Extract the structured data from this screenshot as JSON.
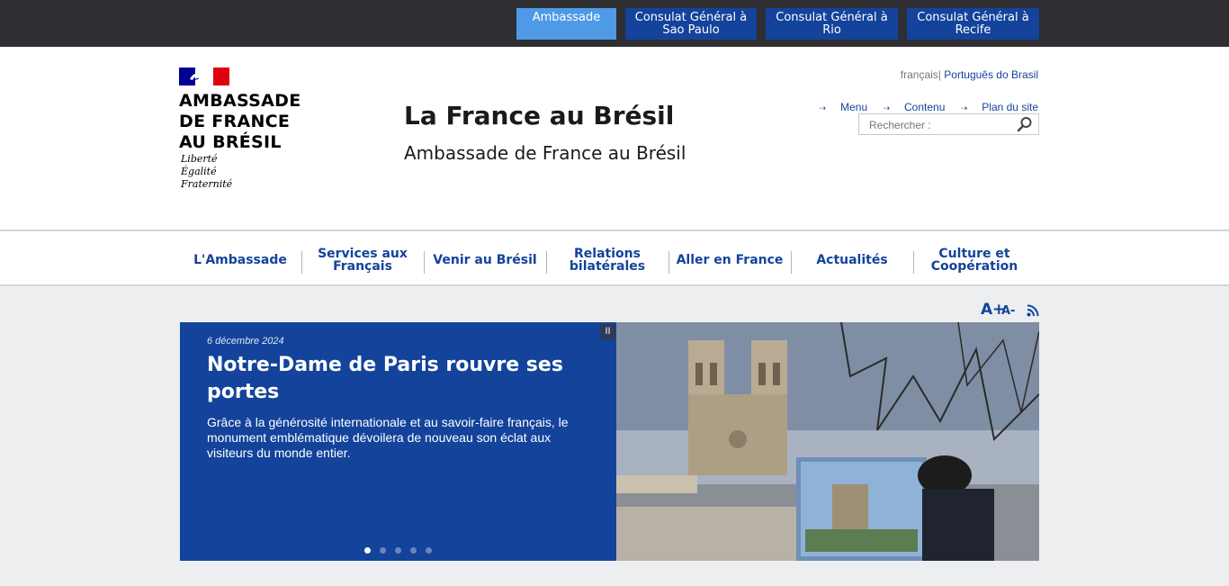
{
  "topbar": {
    "tabs": [
      {
        "label": "Ambassade"
      },
      {
        "label": "Consulat Général à Sao Paulo"
      },
      {
        "label": "Consulat Général à Rio"
      },
      {
        "label": "Consulat Général à Recife"
      }
    ],
    "colors": {
      "bar": "#2e2e33",
      "active": "#4f9ae6",
      "tab": "#13439b"
    }
  },
  "header": {
    "institution": [
      "AMBASSADE",
      "DE FRANCE",
      "AU BRÉSIL"
    ],
    "motto": [
      "Liberté",
      "Égalité",
      "Fraternité"
    ],
    "title": "La France au Brésil",
    "subtitle": "Ambassade de France au Brésil",
    "languages": {
      "current": "français",
      "separator": "|",
      "other": "Português do Brasil"
    },
    "quicklinks": [
      "Menu",
      "Contenu",
      "Plan du site"
    ],
    "search": {
      "placeholder": "Rechercher :"
    }
  },
  "nav": {
    "items": [
      {
        "label": "L'Ambassade"
      },
      {
        "label": "Services aux Français"
      },
      {
        "label": "Venir au Brésil"
      },
      {
        "label": "Relations bilatérales"
      },
      {
        "label": "Aller en France"
      },
      {
        "label": "Actualités"
      },
      {
        "label": "Culture et Coopération"
      }
    ]
  },
  "tools": {
    "increase": "A+",
    "decrease": "A-",
    "rss": "rss-icon"
  },
  "carousel": {
    "date": "6 décembre 2024",
    "title": "Notre-Dame de Paris rouvre ses portes",
    "text": "Grâce à la générosité internationale et au savoir-faire français, le monument emblématique dévoilera de nouveau son éclat aux visiteurs du monde entier.",
    "pause": "II",
    "slides": 5,
    "active_slide": 1,
    "color": "#13439b"
  }
}
